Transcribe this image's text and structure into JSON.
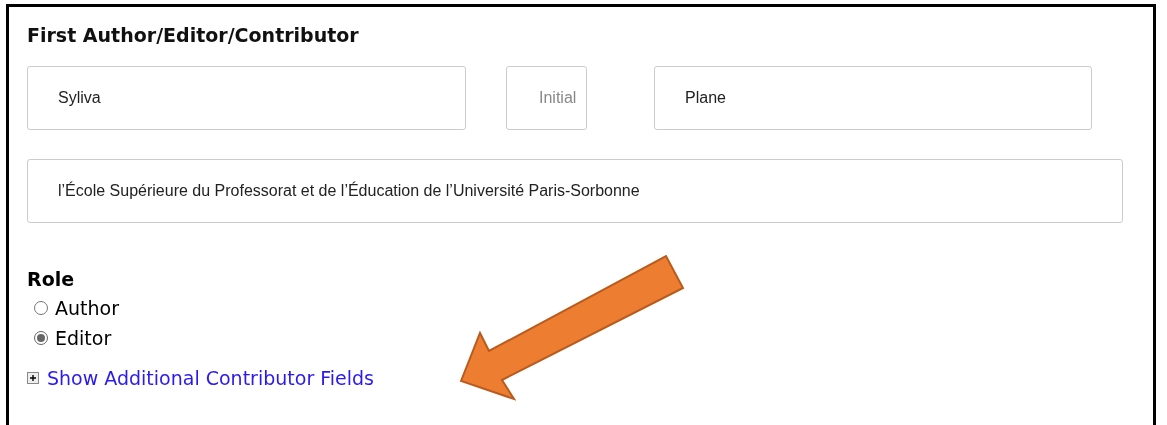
{
  "section": {
    "title": "First Author/Editor/Contributor"
  },
  "name_fields": [
    {
      "value": "Syliva"
    },
    {
      "placeholder": "Initial"
    },
    {
      "value": "Plane"
    }
  ],
  "affiliation_field": {
    "value": "l’École Supérieure du Professorat et de l’Éducation de l’Université Paris-Sorbonne"
  },
  "role": {
    "label": "Role",
    "options": [
      {
        "label": "Author",
        "selected": false
      },
      {
        "label": "Editor",
        "selected": true
      }
    ]
  },
  "toggle_link": {
    "label": "Show Additional Contributor Fields",
    "expanded": false
  },
  "annotation": {
    "kind": "arrow"
  }
}
